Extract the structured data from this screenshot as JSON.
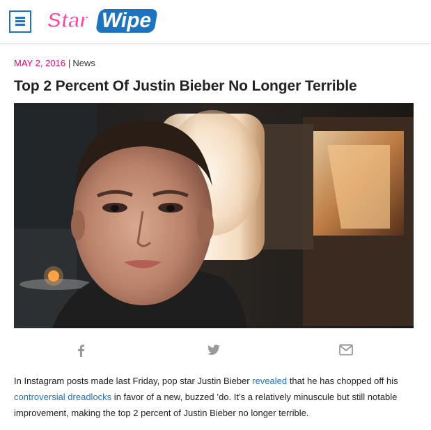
{
  "site": {
    "logo_text_1": "Star",
    "logo_text_2": "Wipe",
    "logo_color_1": "#ff3fa4",
    "logo_color_2": "#1e73be"
  },
  "header": {
    "menu_icon": "hamburger-menu-icon"
  },
  "article": {
    "date": "MAY 2, 2016",
    "separator": "|",
    "category": "News",
    "title": "Top 2 Percent Of Justin Bieber No Longer Terrible",
    "image_subject": "selfie-photo",
    "body": {
      "t1": "In Instagram posts made last Friday, pop star Justin Bieber ",
      "link1": "revealed",
      "t2": " that he has chopped off his ",
      "link2": "controversial dreadlocks",
      "t3": " in favor of a new, buzzed ’do. It’s a relatively minuscule but still notable improvement, making the top 2 percent of Justin Bieber no longer terrible."
    }
  },
  "share": {
    "icons": [
      "facebook-icon",
      "twitter-icon",
      "email-icon"
    ],
    "icon_color": "#999999"
  },
  "colors": {
    "accent_pink": "#e4007c",
    "link_blue": "#1e73be"
  }
}
